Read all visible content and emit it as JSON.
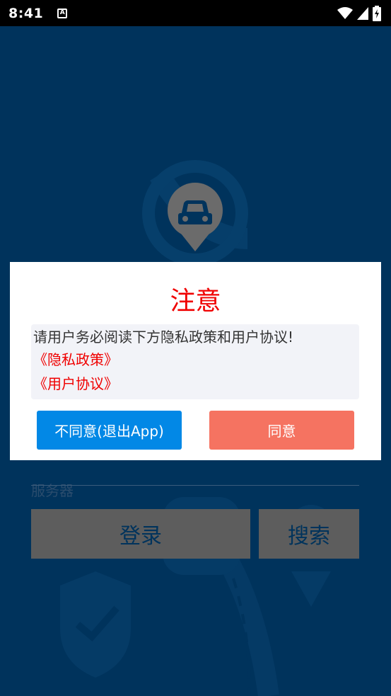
{
  "status_bar": {
    "time": "8:41",
    "notification_icon_text": "A"
  },
  "background_app": {
    "server_label": "服务器",
    "login_button": "登录",
    "search_button": "搜索"
  },
  "dialog": {
    "title": "注意",
    "message": "请用户务必阅读下方隐私政策和用户协议!",
    "privacy_link": "《隐私政策》",
    "user_agreement_link": "《用户协议》",
    "disagree_button": "不同意(退出App)",
    "agree_button": "同意"
  },
  "colors": {
    "background": "#00335c",
    "title_red": "#f00000",
    "disagree_blue": "#0288e6",
    "agree_coral": "#f57361"
  }
}
